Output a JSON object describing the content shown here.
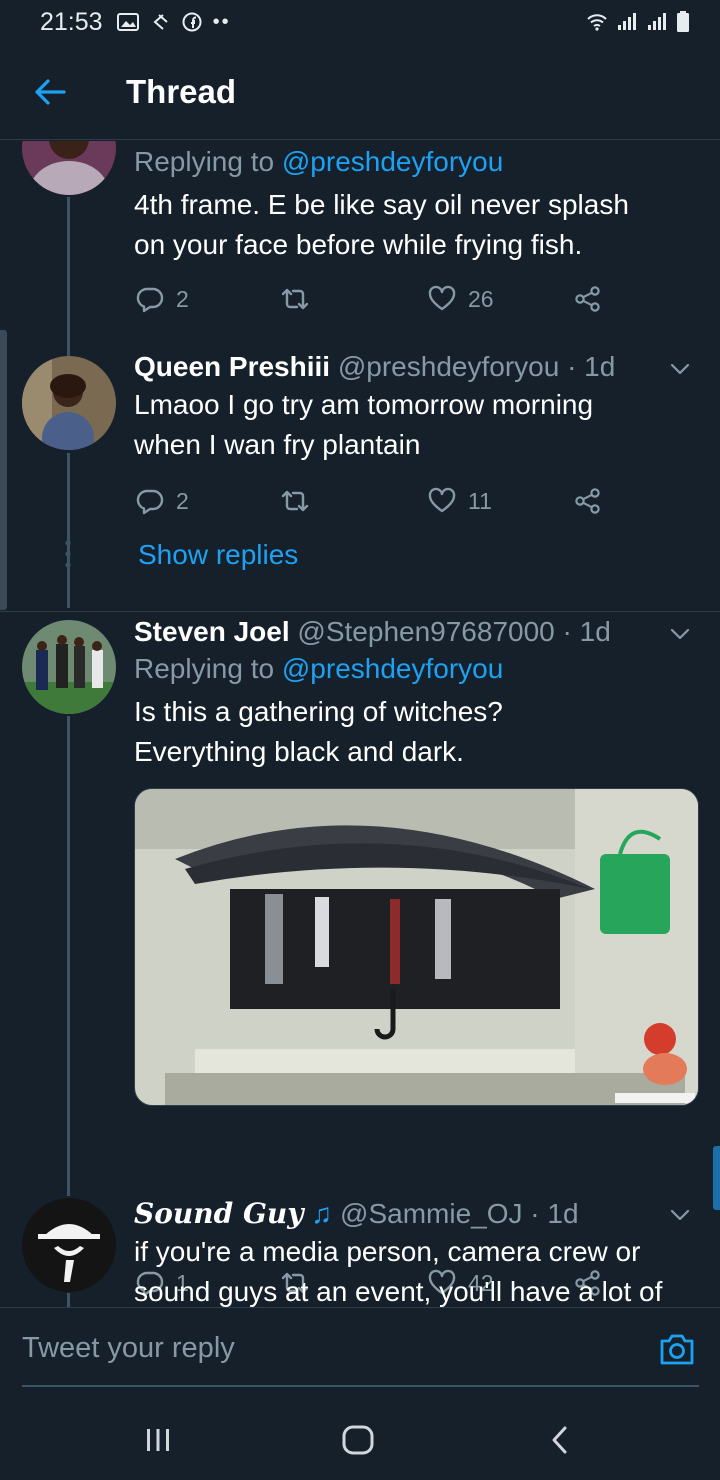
{
  "status_bar": {
    "time": "21:53"
  },
  "header": {
    "title": "Thread"
  },
  "tweets": [
    {
      "reply_prefix": "Replying to",
      "mention": "@preshdeyforyou",
      "text_lines": [
        "4th frame. E be like say oil never splash",
        "on your face before while frying fish."
      ],
      "replies": "2",
      "retweets": "",
      "likes": "26"
    },
    {
      "name": "Queen Preshiii",
      "handle": "@preshdeyforyou",
      "time": "· 1d",
      "text_lines": [
        "Lmaoo I go try am tomorrow morning",
        "when I wan fry plantain"
      ],
      "replies": "2",
      "retweets": "",
      "likes": "11",
      "show_replies": "Show replies"
    },
    {
      "name": "Steven Joel",
      "handle": "@Stephen97687000",
      "time": "· 1d",
      "reply_prefix": "Replying to",
      "mention": "@preshdeyforyou",
      "text_lines": [
        "Is this a gathering of witches?",
        "Everything black and dark."
      ],
      "replies": "1",
      "retweets": "",
      "likes": "42"
    },
    {
      "name": "Sound Guy",
      "handle": "@Sammie_OJ",
      "time": "· 1d",
      "text_lines": [
        "if you're a media person, camera crew or",
        "sound guys at an event, you'll have a lot of"
      ]
    }
  ],
  "reply_bar": {
    "placeholder": "Tweet your reply"
  },
  "colors": {
    "background": "#15202b",
    "accent": "#1da1f2",
    "muted": "#8899a6",
    "like_icon": "heart-icon"
  }
}
